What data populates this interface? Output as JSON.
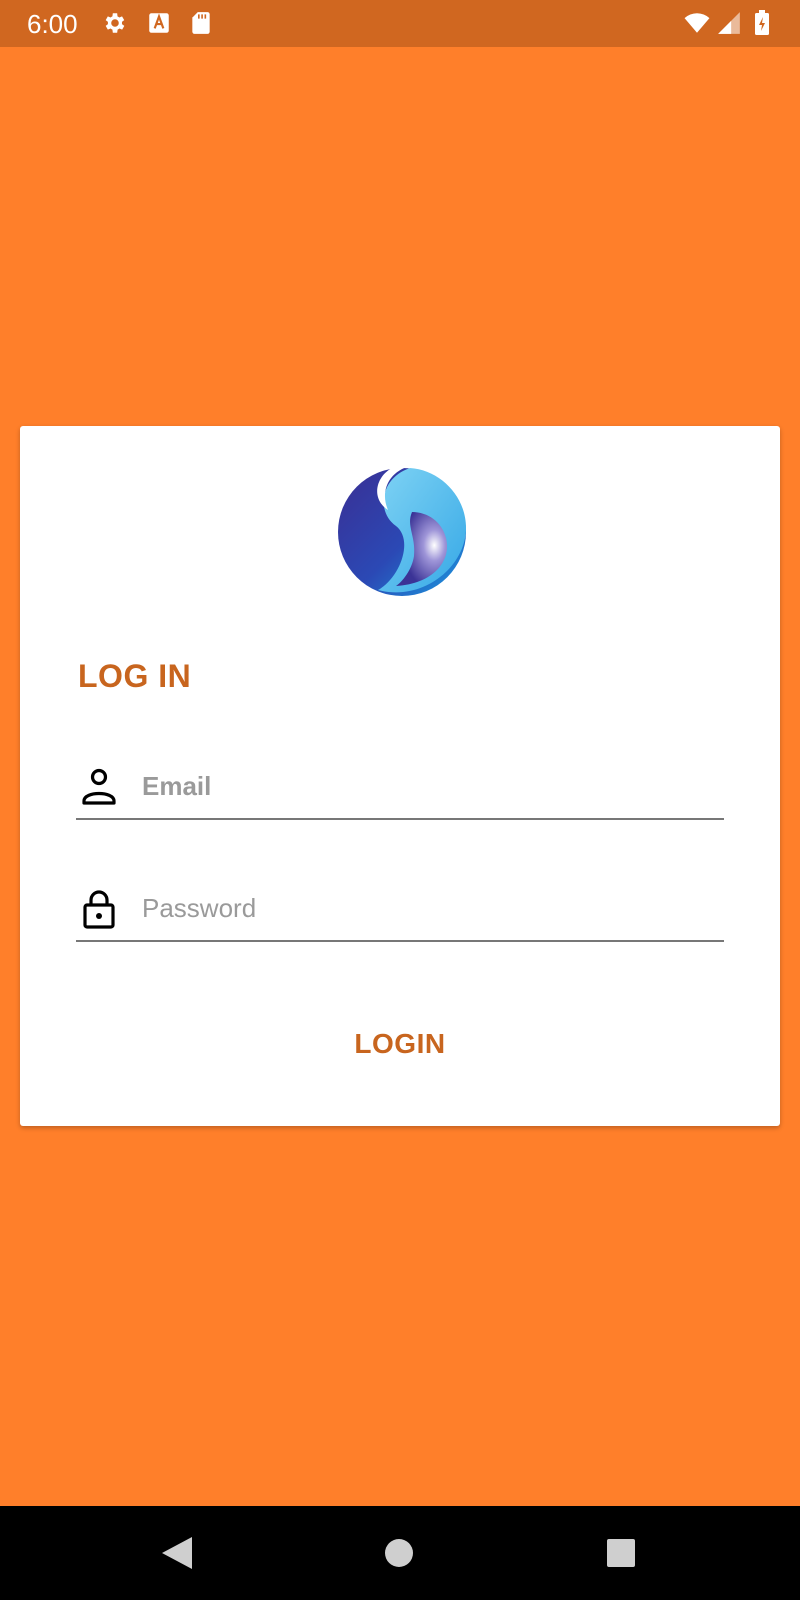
{
  "status_bar": {
    "time": "6:00",
    "icons": [
      "gear-icon",
      "text-a-icon",
      "sd-card-icon",
      "wifi-icon",
      "cell-signal-icon",
      "battery-charging-icon"
    ]
  },
  "login_card": {
    "logo_icon": "brand-logo-icon",
    "title": "LOG IN",
    "email": {
      "icon": "person-icon",
      "value": "",
      "placeholder": "Email"
    },
    "password": {
      "icon": "lock-icon",
      "value": "",
      "placeholder": "Password"
    },
    "login_label": "LOGIN"
  },
  "nav_bar": {
    "icons": [
      "back-icon",
      "home-icon",
      "recents-icon"
    ]
  },
  "colors": {
    "background": "#FF7F2A",
    "status_bar": "#D06720",
    "accent": "#C8651E",
    "card": "#FFFFFF",
    "nav_bar": "#000000"
  }
}
